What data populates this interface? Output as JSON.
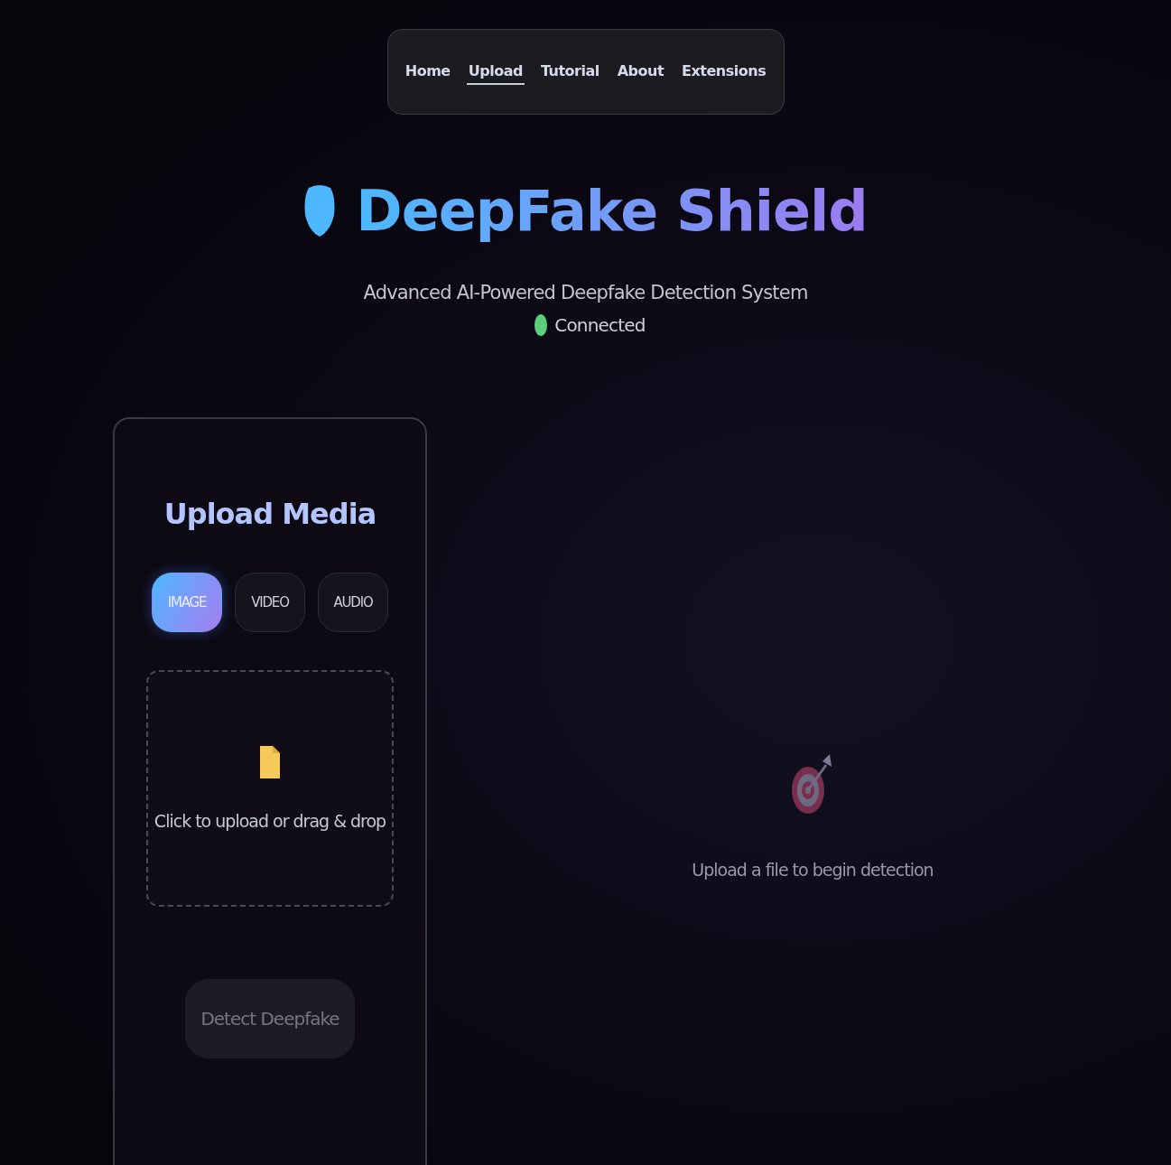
{
  "nav": [
    {
      "label": "Home",
      "selected": false
    },
    {
      "label": "Upload",
      "selected": true
    },
    {
      "label": "Tutorial",
      "selected": false
    },
    {
      "label": "About",
      "selected": false
    },
    {
      "label": "Extensions",
      "selected": false
    }
  ],
  "header": {
    "title": "DeepFake Shield",
    "subtitle": "Advanced AI-Powered Deepfake Detection System",
    "status": {
      "label": "Connected",
      "connected": true
    }
  },
  "upload": {
    "heading": "Upload Media",
    "media_tabs": [
      {
        "label": "IMAGE",
        "selected": true
      },
      {
        "label": "VIDEO",
        "selected": false
      },
      {
        "label": "AUDIO",
        "selected": false
      }
    ],
    "dropzone": {
      "text": "Click to upload or drag & drop"
    },
    "detect_button": {
      "label": "Detect Deepfake",
      "disabled": true
    }
  },
  "results": {
    "placeholder": "Upload a file to begin detection"
  }
}
